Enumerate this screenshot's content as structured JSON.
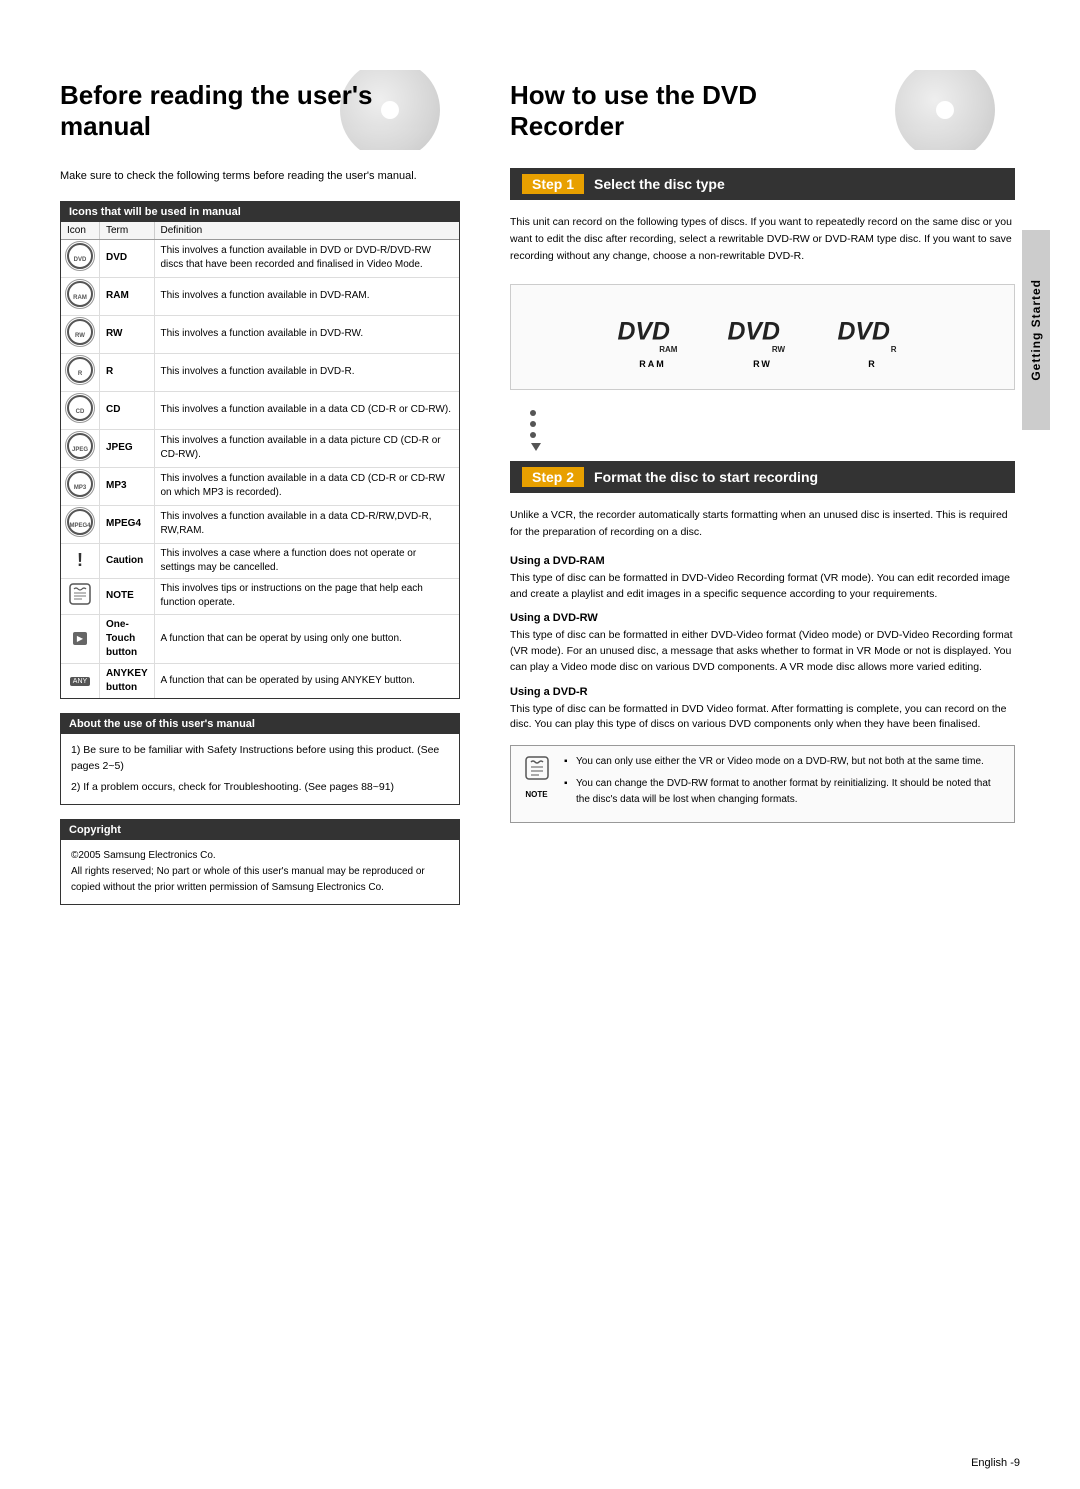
{
  "left": {
    "section_title_line1": "Before reading the user's",
    "section_title_line2": "manual",
    "intro_text": "Make sure to check the following terms before reading the user's manual.",
    "icons_table": {
      "header": "Icons that will be used in manual",
      "columns": [
        "Icon",
        "Term",
        "Definition"
      ],
      "rows": [
        {
          "icon_type": "circle",
          "icon_label": "DVD",
          "term": "DVD",
          "definition": "This involves a function available in DVD or DVD-R/DVD-RW discs that have been recorded and finalised in Video Mode."
        },
        {
          "icon_type": "circle",
          "icon_label": "RAM",
          "term": "RAM",
          "definition": "This involves a function available in DVD-RAM."
        },
        {
          "icon_type": "circle",
          "icon_label": "RW",
          "term": "RW",
          "definition": "This involves a function available in DVD-RW."
        },
        {
          "icon_type": "circle",
          "icon_label": "R",
          "term": "R",
          "definition": "This involves a function available in DVD-R."
        },
        {
          "icon_type": "circle",
          "icon_label": "CD",
          "term": "CD",
          "definition": "This involves a function available in a data CD (CD-R or CD-RW)."
        },
        {
          "icon_type": "circle",
          "icon_label": "JPEG",
          "term": "JPEG",
          "definition": "This involves a function available in a data picture CD (CD-R or CD-RW)."
        },
        {
          "icon_type": "circle",
          "icon_label": "MP3",
          "term": "MP3",
          "definition": "This involves a function available in a data CD (CD-R or CD-RW on which MP3 is recorded)."
        },
        {
          "icon_type": "circle",
          "icon_label": "MPEG4",
          "term": "MPEG4",
          "definition": "This involves a function available in a data CD-R/RW,DVD-R, RW,RAM."
        },
        {
          "icon_type": "exclaim",
          "icon_label": "!",
          "term": "Caution",
          "definition": "This involves a case where a function does not operate or settings may be cancelled."
        },
        {
          "icon_type": "note",
          "icon_label": "NOTE",
          "term": "NOTE",
          "definition": "This involves tips or instructions on the page that help each function operate."
        },
        {
          "icon_type": "onetouch",
          "icon_label": "ONE",
          "term": "One-Touch button",
          "definition": "A function that can be operat by using only one button."
        },
        {
          "icon_type": "anykey",
          "icon_label": "ANYKEY",
          "term": "ANYKEY button",
          "definition": "A function that can be operated by using ANYKEY button."
        }
      ]
    },
    "about_box": {
      "header": "About the use of this user's manual",
      "items": [
        "1) Be sure to be familiar with Safety Instructions before using this product. (See pages 2~5)",
        "2) If a problem occurs, check for Troubleshooting. (See pages 88~91)"
      ]
    },
    "copyright_box": {
      "header": "Copyright",
      "text": "©2005 Samsung Electronics Co.\nAll rights reserved; No part or whole of this user's manual may be reproduced or copied without the prior written permission of Samsung Electronics Co."
    }
  },
  "right": {
    "section_title_line1": "How to use the DVD",
    "section_title_line2": "Recorder",
    "side_tab_label": "Getting Started",
    "step1": {
      "number": "Step 1",
      "title": "Select the disc type",
      "description": "This unit can record on the following types of discs. If you want to repeatedly record on the same disc or you want to edit the disc after recording, select a rewritable DVD-RW or DVD-RAM type disc. If you want to save recording without any change, choose a non-rewritable DVD-R."
    },
    "dvd_logos": [
      {
        "label": "RAM",
        "type": "RAM"
      },
      {
        "label": "RW",
        "type": "RW"
      },
      {
        "label": "R",
        "type": "R"
      }
    ],
    "step2": {
      "number": "Step 2",
      "title": "Format the disc to start recording",
      "description": "Unlike a VCR, the recorder automatically starts formatting when an unused disc is inserted. This is required for the preparation of recording on a disc.",
      "using_dvdram_heading": "Using a DVD-RAM",
      "using_dvdram_text": "This type of disc can be formatted in DVD-Video Recording format (VR mode). You can edit recorded image and create a playlist and edit images in a specific sequence according to your requirements.",
      "using_dvdrw_heading": "Using a DVD-RW",
      "using_dvdrw_text": "This type of disc can be formatted in either DVD-Video format (Video mode) or DVD-Video Recording format (VR mode). For an unused disc, a message that asks whether to format in VR Mode or not is displayed. You can play a Video mode disc on various DVD components. A VR mode disc allows more varied editing.",
      "using_dvdr_heading": "Using a DVD-R",
      "using_dvdr_text": "This type of disc can be formatted in DVD Video format. After formatting is complete, you can record on the disc. You can play this type of discs on various DVD components only when they have been finalised."
    },
    "note_box": {
      "icon_label": "NOTE",
      "items": [
        "You can only use either the VR or Video mode on a DVD-RW, but not both at the same time.",
        "You can change the DVD-RW format to another format by reinitializing. It should be noted that the disc's data will be lost when changing formats."
      ]
    }
  },
  "footer": {
    "text": "English -9"
  }
}
